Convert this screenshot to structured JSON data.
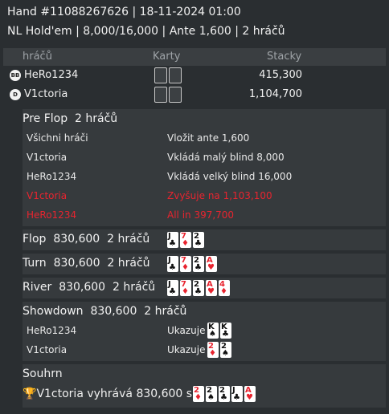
{
  "header": {
    "line1": "Hand #11088267626   | 18-11-2024 01:00",
    "line2": "NL Hold'em | 8,000/16,000 | Ante 1,600 | 2 hráčů"
  },
  "players_table": {
    "col_players": "hráčů",
    "col_cards": "Karty",
    "col_stack": "Stacky",
    "rows": [
      {
        "badge": "BB",
        "name": "HeRo1234",
        "stack": "415,300"
      },
      {
        "badge": "D",
        "name": "V1ctoria",
        "stack": "1,104,700"
      }
    ]
  },
  "preflop": {
    "title": "Pre Flop",
    "count": "2 hráčů",
    "actions": [
      {
        "who": "Všichni hráči",
        "what": "Vložit ante 1,600",
        "highlight": false
      },
      {
        "who": "V1ctoria",
        "what": "Vkládá malý blind 8,000",
        "highlight": false
      },
      {
        "who": "HeRo1234",
        "what": "Vkládá velký blind 16,000",
        "highlight": false
      },
      {
        "who": "V1ctoria",
        "what": "Zvyšuje na 1,103,100",
        "highlight": true
      },
      {
        "who": "HeRo1234",
        "what": "All in 397,700",
        "highlight": true
      }
    ]
  },
  "streets": {
    "flop": {
      "label": "Flop",
      "pot": "830,600",
      "count": "2 hráčů",
      "cards": [
        {
          "r": "J",
          "s": "♣",
          "red": false
        },
        {
          "r": "7",
          "s": "♦",
          "red": true
        },
        {
          "r": "2",
          "s": "♣",
          "red": false
        }
      ]
    },
    "turn": {
      "label": "Turn",
      "pot": "830,600",
      "count": "2 hráčů",
      "cards": [
        {
          "r": "J",
          "s": "♣",
          "red": false
        },
        {
          "r": "7",
          "s": "♦",
          "red": true
        },
        {
          "r": "2",
          "s": "♣",
          "red": false
        },
        {
          "r": "A",
          "s": "♥",
          "red": true
        }
      ]
    },
    "river": {
      "label": "River",
      "pot": "830,600",
      "count": "2 hráčů",
      "cards": [
        {
          "r": "J",
          "s": "♣",
          "red": false
        },
        {
          "r": "7",
          "s": "♦",
          "red": true
        },
        {
          "r": "2",
          "s": "♣",
          "red": false
        },
        {
          "r": "A",
          "s": "♥",
          "red": true
        },
        {
          "r": "4",
          "s": "♦",
          "red": true
        }
      ]
    }
  },
  "showdown": {
    "label": "Showdown",
    "pot": "830,600",
    "count": "2 hráčů",
    "shows_label": "Ukazuje",
    "rows": [
      {
        "name": "HeRo1234",
        "cards": [
          {
            "r": "K",
            "s": "♠",
            "red": false
          },
          {
            "r": "K",
            "s": "♣",
            "red": false
          }
        ]
      },
      {
        "name": "V1ctoria",
        "cards": [
          {
            "r": "2",
            "s": "♦",
            "red": true
          },
          {
            "r": "2",
            "s": "♠",
            "red": false
          }
        ]
      }
    ]
  },
  "summary": {
    "title": "Souhrn",
    "winner_text": "V1ctoria vyhrává 830,600 s",
    "cards": [
      {
        "r": "2",
        "s": "♦",
        "red": true
      },
      {
        "r": "2",
        "s": "♠",
        "red": false
      },
      {
        "r": "2",
        "s": "♣",
        "red": false
      },
      {
        "r": "J",
        "s": "♣",
        "red": false
      },
      {
        "r": "A",
        "s": "♥",
        "red": true
      }
    ]
  },
  "colors": {
    "background": "#2a2e31",
    "panel": "#363a3d",
    "accent_red": "#e8242f"
  },
  "icons": [
    "bb-badge-icon",
    "dealer-badge-icon",
    "trophy-icon"
  ]
}
